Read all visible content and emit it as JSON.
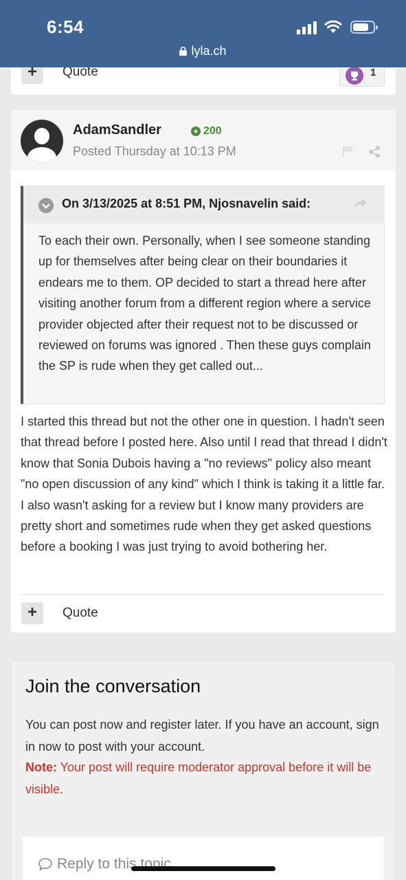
{
  "status": {
    "time": "6:54",
    "url": "lyla.ch"
  },
  "prev_post": {
    "quote_label": "Quote",
    "reaction_count": "1"
  },
  "post": {
    "author": "AdamSandler",
    "reputation": "200",
    "posted": "Posted Thursday at 10:13 PM",
    "quote_cite": "On 3/13/2025 at 8:51 PM, Njosnavelin said:",
    "quote_text": "To each their own. Personally, when I see someone standing up for themselves after being clear on their boundaries it endears me to them. OP decided to start a thread here after visiting another forum from a different region where a service provider objected after their request not to be discussed or reviewed on forums was ignored . Then these guys complain the SP is rude when they get called out...",
    "body": "I started this thread but not the other one in question. I hadn't seen that thread before I posted here. Also until I read that thread I didn't know that Sonia Dubois having a \"no reviews\" policy also meant \"no open discussion of any kind\" which I think is taking it a little far. I also wasn't asking for a review but I know many providers are pretty short and sometimes rude when they get asked questions before a booking I was just trying to avoid bothering her.",
    "quote_label": "Quote"
  },
  "join": {
    "title": "Join the conversation",
    "info": "You can post now and register later. If you have an account, sign in now to post with your account.",
    "note_label": "Note:",
    "note_text": " Your post will require moderator approval before it will be visible.",
    "reply_placeholder": "Reply to this topic..."
  },
  "colors": {
    "header": "#3e6494",
    "reputation": "#4a8a3b",
    "note": "#c0392b"
  }
}
